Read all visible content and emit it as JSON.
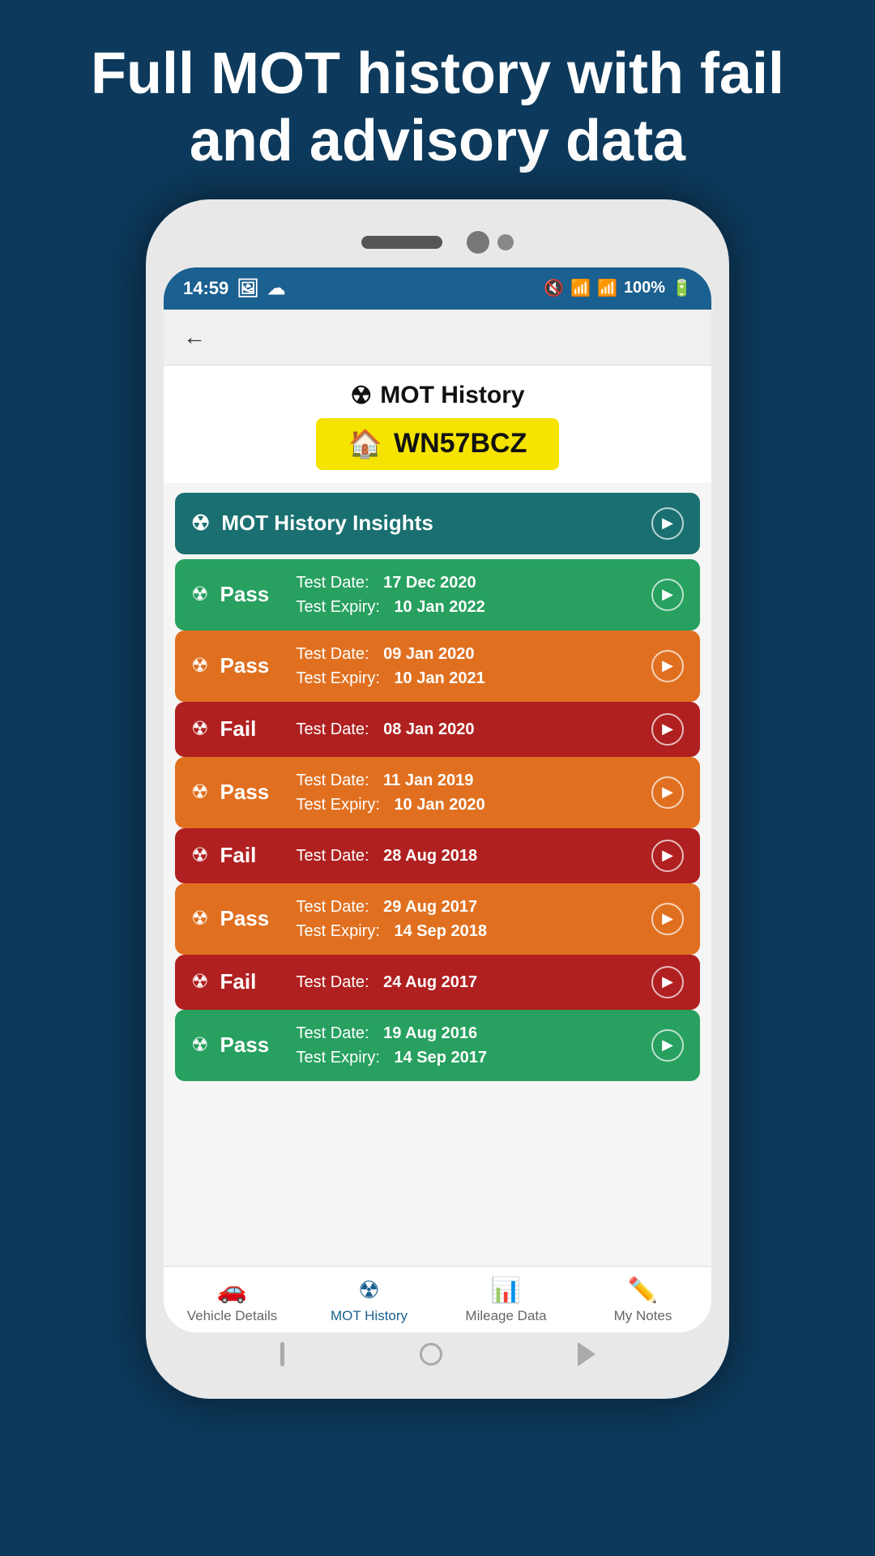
{
  "headline": "Full MOT history with fail and advisory data",
  "statusBar": {
    "time": "14:59",
    "battery": "100%"
  },
  "header": {
    "title": "MOT History",
    "regPlate": "WN57BCZ"
  },
  "insights": {
    "label": "MOT History Insights"
  },
  "motItems": [
    {
      "result": "Pass",
      "color": "green",
      "testDate": "17 Dec 2020",
      "expiryDate": "10 Jan 2022",
      "hasTwoLines": true
    },
    {
      "result": "Pass",
      "color": "orange",
      "testDate": "09 Jan 2020",
      "expiryDate": "10 Jan 2021",
      "hasTwoLines": true
    },
    {
      "result": "Fail",
      "color": "red",
      "testDate": "08 Jan 2020",
      "expiryDate": null,
      "hasTwoLines": false
    },
    {
      "result": "Pass",
      "color": "orange",
      "testDate": "11 Jan 2019",
      "expiryDate": "10 Jan 2020",
      "hasTwoLines": true
    },
    {
      "result": "Fail",
      "color": "red",
      "testDate": "28 Aug 2018",
      "expiryDate": null,
      "hasTwoLines": false
    },
    {
      "result": "Pass",
      "color": "orange",
      "testDate": "29 Aug 2017",
      "expiryDate": "14 Sep 2018",
      "hasTwoLines": true
    },
    {
      "result": "Fail",
      "color": "red",
      "testDate": "24 Aug 2017",
      "expiryDate": null,
      "hasTwoLines": false
    },
    {
      "result": "Pass",
      "color": "green",
      "testDate": "19 Aug 2016",
      "expiryDate": "14 Sep 2017",
      "hasTwoLines": true
    }
  ],
  "bottomNav": [
    {
      "label": "Vehicle Details",
      "icon": "🚗",
      "active": false
    },
    {
      "label": "MOT History",
      "icon": "☢",
      "active": true
    },
    {
      "label": "Mileage Data",
      "icon": "📊",
      "active": false
    },
    {
      "label": "My Notes",
      "icon": "✏️",
      "active": false
    }
  ],
  "labels": {
    "testDate": "Test Date:",
    "testExpiry": "Test Expiry:"
  }
}
